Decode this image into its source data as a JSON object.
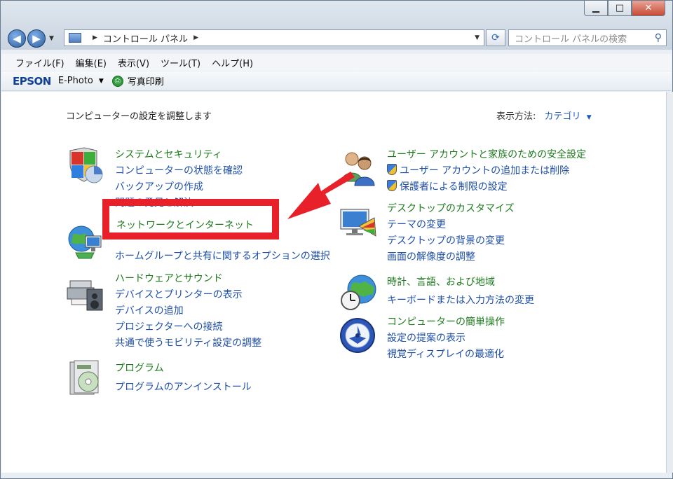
{
  "window": {
    "minimize": "▁",
    "maximize": "□",
    "close": "✕"
  },
  "address": {
    "path": "コントロール パネル",
    "search_placeholder": "コントロール パネルの検索"
  },
  "menu": [
    "ファイル(F)",
    "編集(E)",
    "表示(V)",
    "ツール(T)",
    "ヘルプ(H)"
  ],
  "epson_bar": {
    "logo": "EPSON",
    "ephoto": "E-Photo",
    "print": "写真印刷"
  },
  "content": {
    "heading": "コンピューターの設定を調整します",
    "view_by_label": "表示方法:",
    "view_by_value": "カテゴリ"
  },
  "categories": {
    "system": {
      "title": "システムとセキュリティ",
      "links": [
        "コンピューターの状態を確認",
        "バックアップの作成",
        "問題の発見と解決"
      ]
    },
    "network": {
      "title": "ネットワークとインターネット",
      "links": [
        "ホームグループと共有に関するオプションの選択"
      ]
    },
    "hardware": {
      "title": "ハードウェアとサウンド",
      "links": [
        "デバイスとプリンターの表示",
        "デバイスの追加",
        "プロジェクターへの接続",
        "共通で使うモビリティ設定の調整"
      ]
    },
    "programs": {
      "title": "プログラム",
      "links": [
        "プログラムのアンインストール"
      ]
    },
    "users": {
      "title": "ユーザー アカウントと家族のための安全設定",
      "links": [
        "ユーザー アカウントの追加または削除",
        "保護者による制限の設定"
      ]
    },
    "appearance": {
      "title": "デスクトップのカスタマイズ",
      "links": [
        "テーマの変更",
        "デスクトップの背景の変更",
        "画面の解像度の調整"
      ]
    },
    "clock": {
      "title": "時計、言語、および地域",
      "links": [
        "キーボードまたは入力方法の変更"
      ]
    },
    "ease": {
      "title": "コンピューターの簡単操作",
      "links": [
        "設定の提案の表示",
        "視覚ディスプレイの最適化"
      ]
    }
  },
  "colors": {
    "category_title": "#1e7a1e",
    "link": "#1e4fa8",
    "annotation": "#e8202a"
  }
}
